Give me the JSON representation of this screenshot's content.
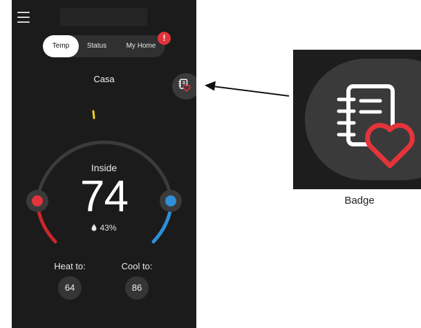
{
  "app": {
    "location_name": "Casa"
  },
  "tabs": [
    {
      "label": "Temp",
      "selected": true
    },
    {
      "label": "Status",
      "selected": false
    },
    {
      "label": "My Home",
      "selected": false
    }
  ],
  "alert_badge": {
    "text": "!",
    "color": "#e0343b"
  },
  "thermostat": {
    "inside_label": "Inside",
    "indoor_temp": "74",
    "humidity": "43%",
    "heat_label": "Heat to:",
    "heat_setpoint": "64",
    "cool_label": "Cool to:",
    "cool_setpoint": "86"
  },
  "colors": {
    "heat": "#e3343a",
    "cool": "#2e8fd8",
    "indicator": "#f2d21b",
    "background": "#1b1b1b"
  },
  "icons": {
    "menu": "menu-icon",
    "badge": "notebook-heart-icon",
    "humidity": "water-drop-icon"
  },
  "callout": {
    "label": "Badge"
  }
}
